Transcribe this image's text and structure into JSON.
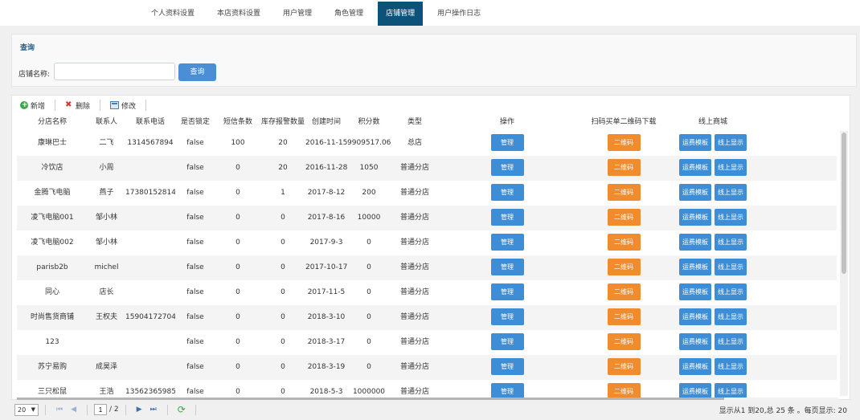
{
  "tabs": [
    "个人资料设置",
    "本店资料设置",
    "用户管理",
    "角色管理",
    "店铺管理",
    "用户操作日志"
  ],
  "active_tab": 4,
  "query": {
    "title": "查询",
    "label": "店铺名称:",
    "input_value": "",
    "button": "查询"
  },
  "toolbar": {
    "add": "新增",
    "delete": "删除",
    "edit": "修改"
  },
  "columns": [
    "分店名称",
    "联系人",
    "联系电话",
    "是否锁定",
    "短信条数",
    "库存报警数量",
    "创建时间",
    "积分数",
    "类型",
    "操作",
    "扫码买单二维码下载",
    "线上商城"
  ],
  "row_buttons": {
    "manage": "管理",
    "qr": "二维码",
    "freight": "运费模板",
    "online": "线上显示"
  },
  "rows": [
    [
      "康琳巴士",
      "二飞",
      "1314567894",
      "false",
      "100",
      "20",
      "2016-11-15",
      "9909517.06",
      "总店"
    ],
    [
      "冷饮店",
      "小周",
      "",
      "false",
      "0",
      "20",
      "2016-11-28",
      "1050",
      "普通分店"
    ],
    [
      "金腾飞电脑",
      "燕子",
      "17380152814",
      "false",
      "0",
      "1",
      "2017-8-12",
      "200",
      "普通分店"
    ],
    [
      "凌飞电脑001",
      "邹小林",
      "",
      "false",
      "0",
      "0",
      "2017-8-16",
      "10000",
      "普通分店"
    ],
    [
      "凌飞电脑002",
      "邹小林",
      "",
      "false",
      "0",
      "0",
      "2017-9-3",
      "0",
      "普通分店"
    ],
    [
      "parisb2b",
      "michel",
      "",
      "false",
      "0",
      "0",
      "2017-10-17",
      "0",
      "普通分店"
    ],
    [
      "同心",
      "店长",
      "",
      "false",
      "0",
      "0",
      "2017-11-5",
      "0",
      "普通分店"
    ],
    [
      "时尚售货商铺",
      "王权夫",
      "15904172704",
      "false",
      "0",
      "0",
      "2018-3-10",
      "0",
      "普通分店"
    ],
    [
      "123",
      "",
      "",
      "false",
      "0",
      "0",
      "2018-3-17",
      "0",
      "普通分店"
    ],
    [
      "苏宁易购",
      "成昊泽",
      "",
      "false",
      "0",
      "0",
      "2018-3-19",
      "0",
      "普通分店"
    ],
    [
      "三只松鼠",
      "王浩",
      "13562365985",
      "false",
      "0",
      "0",
      "2018-5-3",
      "1000000",
      "普通分店"
    ]
  ],
  "pager": {
    "page_size": "20",
    "current_page": "1",
    "total_pages": "/ 2",
    "info": "显示从1 到20,总 25 条 。每页显示: 20"
  },
  "colors": {
    "active_tab": "#0d5278",
    "primary_button": "#3d8ed6",
    "qr_button": "#f08b2e"
  }
}
